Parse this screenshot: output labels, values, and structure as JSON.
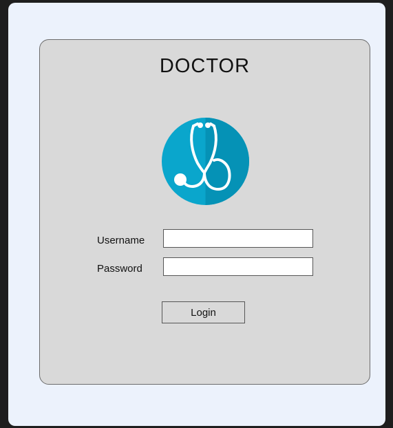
{
  "login_form": {
    "title": "DOCTOR",
    "logo_icon": "stethoscope-icon",
    "username_label": "Username",
    "username_value": "",
    "password_label": "Password",
    "password_value": "",
    "login_label": "Login"
  },
  "colors": {
    "page_background": "#ecf2fc",
    "card_background": "#d9d9d9",
    "logo_circle": "#0aa6cc",
    "logo_shadow": "#0592b6"
  }
}
